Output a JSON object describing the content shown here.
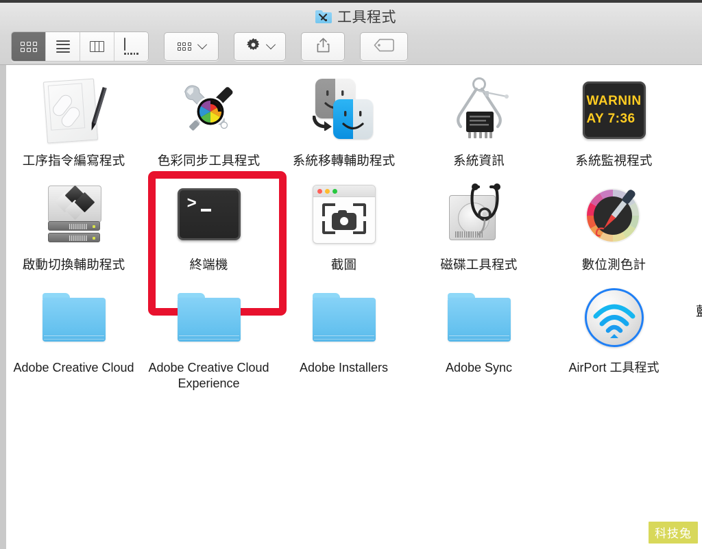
{
  "window": {
    "title": "工具程式",
    "folder_icon": "utilities-folder-icon"
  },
  "toolbar": {
    "view_modes": [
      {
        "name": "icon-view",
        "icon": "grid-icon",
        "selected": true
      },
      {
        "name": "list-view",
        "icon": "list-icon",
        "selected": false
      },
      {
        "name": "column-view",
        "icon": "columns-icon",
        "selected": false
      },
      {
        "name": "gallery-view",
        "icon": "gallery-icon",
        "selected": false
      }
    ],
    "arrange_button": {
      "icon": "arrange-grid-icon",
      "chevron": "chevron-down-icon"
    },
    "action_button": {
      "icon": "gear-icon",
      "chevron": "chevron-down-icon"
    },
    "share_button": {
      "icon": "share-icon"
    },
    "tag_button": {
      "icon": "tag-icon"
    }
  },
  "content": {
    "rows": [
      {
        "items": [
          {
            "label": "工序指令編寫程式",
            "icon": "script-editor-icon",
            "kind": "app",
            "latin": false
          },
          {
            "label": "色彩同步工具程式",
            "icon": "colorsync-utility-icon",
            "kind": "app",
            "latin": false
          },
          {
            "label": "系統移轉輔助程式",
            "icon": "migration-assistant-icon",
            "kind": "app",
            "latin": false
          },
          {
            "label": "系統資訊",
            "icon": "system-information-icon",
            "kind": "app",
            "latin": false
          },
          {
            "label": "系統監視程式",
            "icon": "console-icon",
            "kind": "app",
            "latin": false
          }
        ]
      },
      {
        "items": [
          {
            "label": "啟動切換輔助程式",
            "icon": "boot-camp-assistant-icon",
            "kind": "app",
            "latin": false
          },
          {
            "label": "終端機",
            "icon": "terminal-icon",
            "kind": "app",
            "latin": false,
            "highlighted": true
          },
          {
            "label": "截圖",
            "icon": "screenshot-icon",
            "kind": "app",
            "latin": false
          },
          {
            "label": "磁碟工具程式",
            "icon": "disk-utility-icon",
            "kind": "app",
            "latin": false
          },
          {
            "label": "數位測色計",
            "icon": "digital-color-meter-icon",
            "kind": "app",
            "latin": false
          }
        ]
      },
      {
        "items": [
          {
            "label": "Adobe Creative Cloud",
            "icon": "folder-icon",
            "kind": "folder",
            "latin": true
          },
          {
            "label": "Adobe Creative Cloud Experience",
            "icon": "folder-icon",
            "kind": "folder",
            "latin": true
          },
          {
            "label": "Adobe Installers",
            "icon": "folder-icon",
            "kind": "folder",
            "latin": true
          },
          {
            "label": "Adobe Sync",
            "icon": "folder-icon",
            "kind": "folder",
            "latin": true
          },
          {
            "label": "AirPort 工具程式",
            "icon": "airport-utility-icon",
            "kind": "app",
            "latin": true
          }
        ]
      }
    ],
    "clipped_label_right_edge": "藍"
  },
  "console_icon_text": {
    "line1": "WARNIN",
    "line2": "AY 7:36"
  },
  "terminal_icon_text": {
    "prompt": ">"
  },
  "highlight": {
    "color": "#e8112d",
    "target": "終端機"
  },
  "watermark": {
    "text": "科技兔",
    "background": "#d8d85a",
    "color": "#ffffff"
  },
  "colors": {
    "titlebar_top": "#e7e7e7",
    "titlebar_bottom": "#d2d2d2",
    "content_background": "#ffffff",
    "label_text": "#1d1d1d",
    "folder_blue": "#62c0ee",
    "console_yellow": "#ffcc22"
  }
}
